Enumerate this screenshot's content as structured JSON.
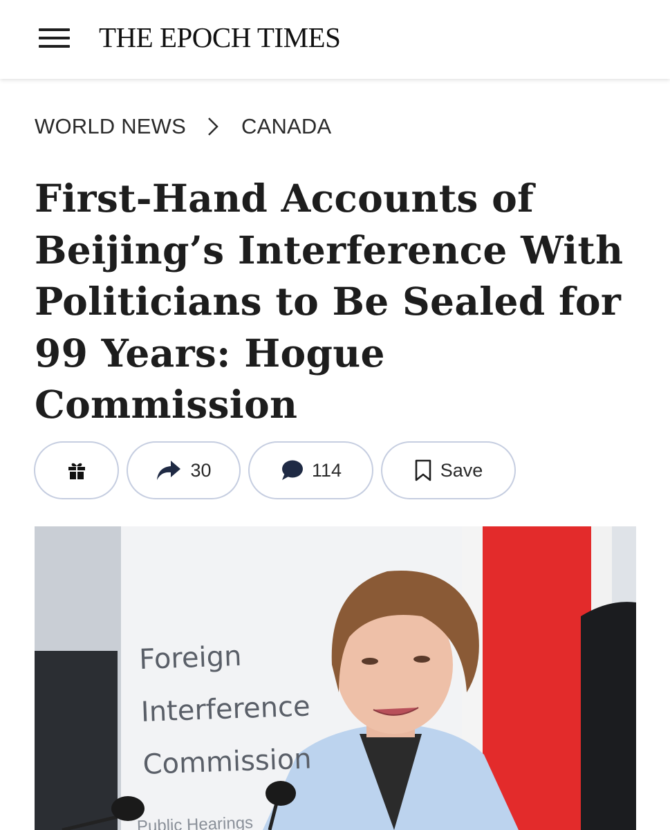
{
  "header": {
    "brand": "THE EPOCH TIMES"
  },
  "breadcrumb": {
    "section": "WORLD NEWS",
    "subsection": "CANADA"
  },
  "article": {
    "title_lines": [
      "First-Hand Accounts of",
      "Beijing’s Interference With",
      "Politicians to Be Sealed for",
      "99 Years: Hogue",
      "Commission"
    ]
  },
  "actions": {
    "share_count": "30",
    "comment_count": "114",
    "save_label": "Save"
  },
  "hero_image": {
    "sign_lines": [
      "Foreign",
      "Interference",
      "Commission"
    ],
    "sign_subtext": "Public Hearings"
  },
  "colors": {
    "text": "#1e1e1e",
    "button_border": "#c5cde0",
    "icon_navy": "#1f2a44",
    "flag_red": "#e32b2b"
  }
}
